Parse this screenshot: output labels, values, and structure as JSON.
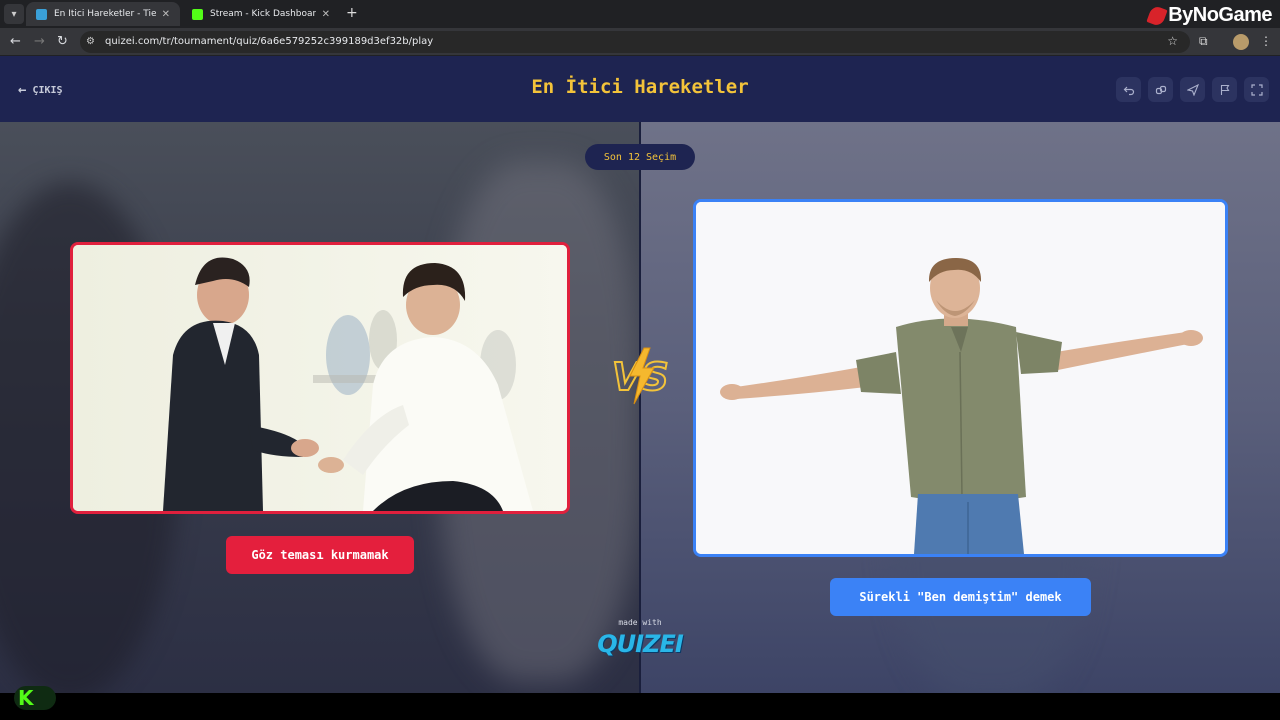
{
  "browser": {
    "tabs": [
      {
        "title": "En İtici Hareketler - Tier List, Ko",
        "active": true
      },
      {
        "title": "Stream - Kick Dashboard",
        "active": false
      }
    ],
    "url": "quizei.com/tr/tournament/quiz/6a6e579252c399189d3ef32b/play",
    "overlay_logo": "ByNoGame"
  },
  "header": {
    "exit_label": "ÇIKIŞ",
    "title": "En İtici Hareketler"
  },
  "round": {
    "label": "Son 12 Seçim"
  },
  "choices": {
    "left": {
      "label": "Göz teması kurmamak"
    },
    "right": {
      "label": "Sürekli \"Ben demiştim\" demek"
    }
  },
  "vs_text": "VS",
  "footer": {
    "made_with": "made with",
    "brand": "QUIZEI"
  },
  "colors": {
    "title": "#f3c33a",
    "left_accent": "#e41f3d",
    "right_accent": "#3b82f6",
    "header_bg": "#1e2451"
  }
}
